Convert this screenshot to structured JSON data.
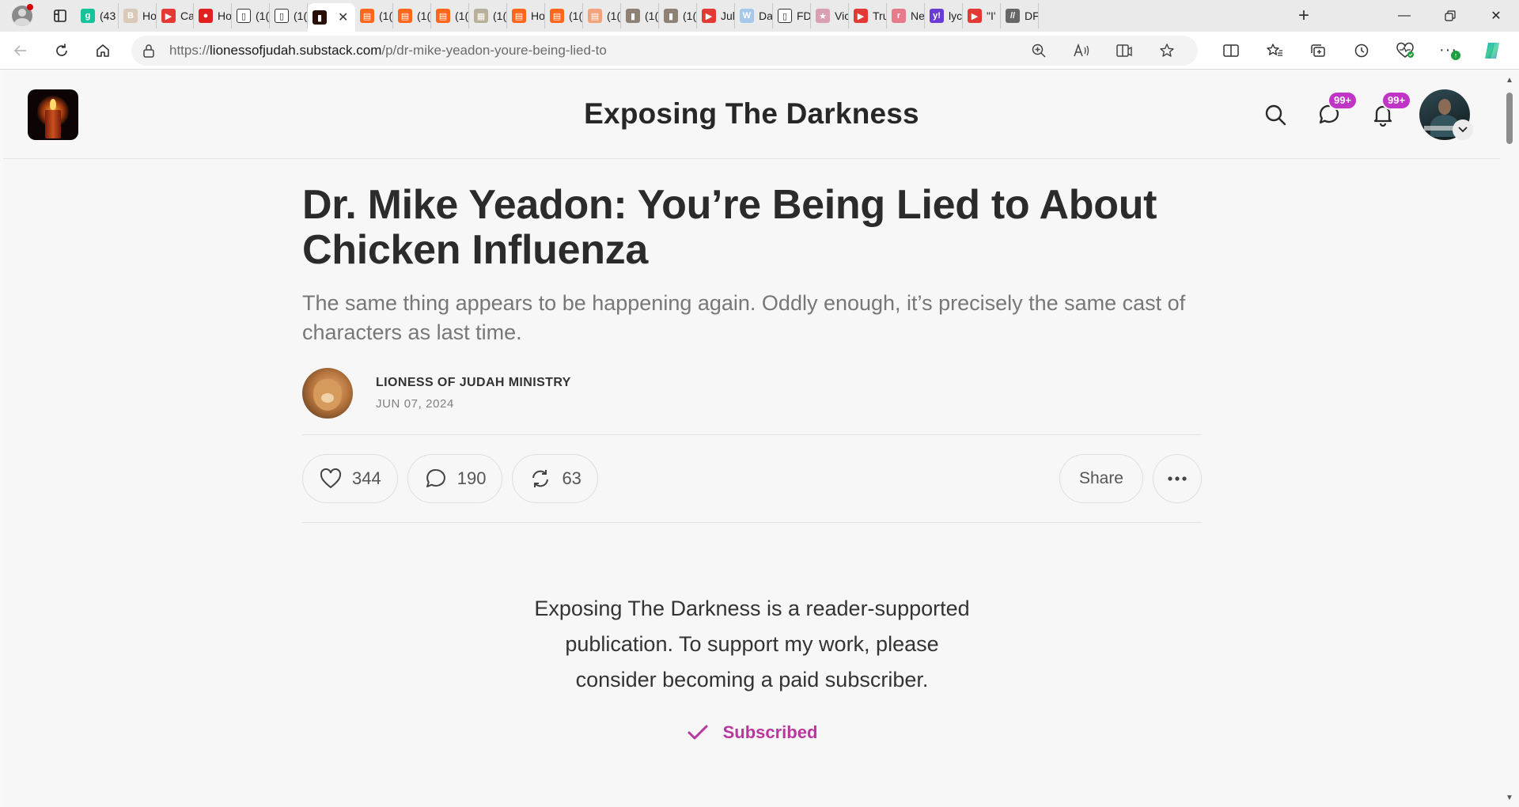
{
  "browser": {
    "tabs": [
      {
        "icon": "grammarly-icon",
        "label": "(43",
        "color": "#15c39a",
        "glyph": "g"
      },
      {
        "icon": "page-icon",
        "label": "Ho",
        "color": "#d9c9b8",
        "glyph": "B"
      },
      {
        "icon": "youtube-icon",
        "label": "Ca",
        "color": "#e53935",
        "glyph": "▶"
      },
      {
        "icon": "app-icon",
        "label": "Ho",
        "color": "#e02020",
        "glyph": "●"
      },
      {
        "icon": "document-icon",
        "label": "(1(",
        "color": "#ffffff",
        "glyph": "▯"
      },
      {
        "icon": "document-icon",
        "label": "(1(",
        "color": "#ffffff",
        "glyph": "▯"
      },
      {
        "icon": "candle-icon",
        "label": "",
        "color": "#2a0d05",
        "glyph": "▮",
        "active": true
      },
      {
        "icon": "substack-icon",
        "label": "(1(",
        "color": "#ff6719",
        "glyph": "▤"
      },
      {
        "icon": "substack-icon",
        "label": "(1(",
        "color": "#ff6719",
        "glyph": "▤"
      },
      {
        "icon": "substack-icon",
        "label": "(1(",
        "color": "#ff6719",
        "glyph": "▤"
      },
      {
        "icon": "image-icon",
        "label": "(1(",
        "color": "#b9b09a",
        "glyph": "▦"
      },
      {
        "icon": "substack-icon",
        "label": "Ho",
        "color": "#ff6719",
        "glyph": "▤"
      },
      {
        "icon": "substack-icon",
        "label": "(1(",
        "color": "#ff6719",
        "glyph": "▤"
      },
      {
        "icon": "substack-faded-icon",
        "label": "(1(",
        "color": "#f2a37c",
        "glyph": "▤"
      },
      {
        "icon": "person-photo-icon",
        "label": "(1(",
        "color": "#8f8173",
        "glyph": "▮"
      },
      {
        "icon": "person-photo-icon",
        "label": "(1(",
        "color": "#8f8173",
        "glyph": "▮"
      },
      {
        "icon": "youtube-icon",
        "label": "Jul",
        "color": "#e53935",
        "glyph": "▶"
      },
      {
        "icon": "web-icon",
        "label": "Da",
        "color": "#a6c8ea",
        "glyph": "W"
      },
      {
        "icon": "document-icon",
        "label": "FD",
        "color": "#ffffff",
        "glyph": "▯"
      },
      {
        "icon": "star-badge-icon",
        "label": "Vic",
        "color": "#d9a0b5",
        "glyph": "★"
      },
      {
        "icon": "youtube-icon",
        "label": "Tru",
        "color": "#e53935",
        "glyph": "▶"
      },
      {
        "icon": "r-icon",
        "label": "Ne",
        "color": "#e87b8b",
        "glyph": "r"
      },
      {
        "icon": "yahoo-icon",
        "label": "lyc",
        "color": "#6b3bd6",
        "glyph": "y!"
      },
      {
        "icon": "youtube-icon",
        "label": "\"I'",
        "color": "#e53935",
        "glyph": "▶"
      },
      {
        "icon": "slashes-icon",
        "label": "DF",
        "color": "#666666",
        "glyph": "//"
      }
    ],
    "window_controls": [
      "minimize-icon",
      "restore-icon",
      "close-icon"
    ],
    "url_prefix": "https://",
    "url_domain": "lionessofjudah.substack.com",
    "url_path": "/p/dr-mike-yeadon-youre-being-lied-to"
  },
  "site": {
    "title": "Exposing The Darkness",
    "chat_badge": "99+",
    "notification_badge": "99+"
  },
  "post": {
    "title": "Dr. Mike Yeadon: You’re Being Lied to About Chicken Influenza",
    "subtitle": "The same thing appears to be happening again. Oddly enough, it’s precisely the same cast of characters as last time.",
    "author": "LIONESS OF JUDAH MINISTRY",
    "date": "JUN 07, 2024",
    "likes": "344",
    "comments": "190",
    "restacks": "63",
    "share_label": "Share"
  },
  "subscribe": {
    "text": "Exposing The Darkness is a reader-supported publication. To support my work, please consider becoming a paid subscriber.",
    "status": "Subscribed"
  },
  "colors": {
    "accent": "#b8379e",
    "badge": "#c034c6"
  }
}
